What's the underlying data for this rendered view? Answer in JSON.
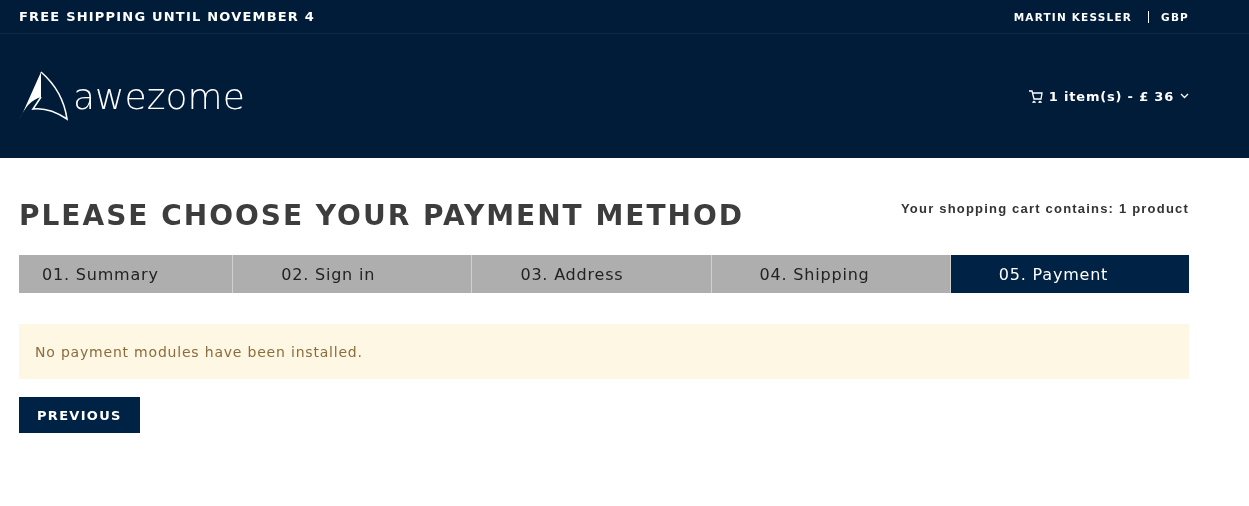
{
  "top_bar": {
    "promo": "FREE SHIPPING UNTIL NOVEMBER 4",
    "account": "MARTIN KESSLER",
    "currency": "GBP"
  },
  "header": {
    "logo_text": "awezome",
    "cart": "1 item(s) - £ 36"
  },
  "page": {
    "title": "PLEASE CHOOSE YOUR PAYMENT METHOD",
    "cart_summary": "Your shopping cart contains: 1 product"
  },
  "steps": [
    {
      "label": "01. Summary",
      "selected": false
    },
    {
      "label": "02. Sign in",
      "selected": false
    },
    {
      "label": "03. Address",
      "selected": false
    },
    {
      "label": "04. Shipping",
      "selected": false
    },
    {
      "label": "05. Payment",
      "selected": true
    }
  ],
  "alert": {
    "message": "No payment modules have been installed."
  },
  "buttons": [
    {
      "label": "PREVIOUS"
    }
  ]
}
